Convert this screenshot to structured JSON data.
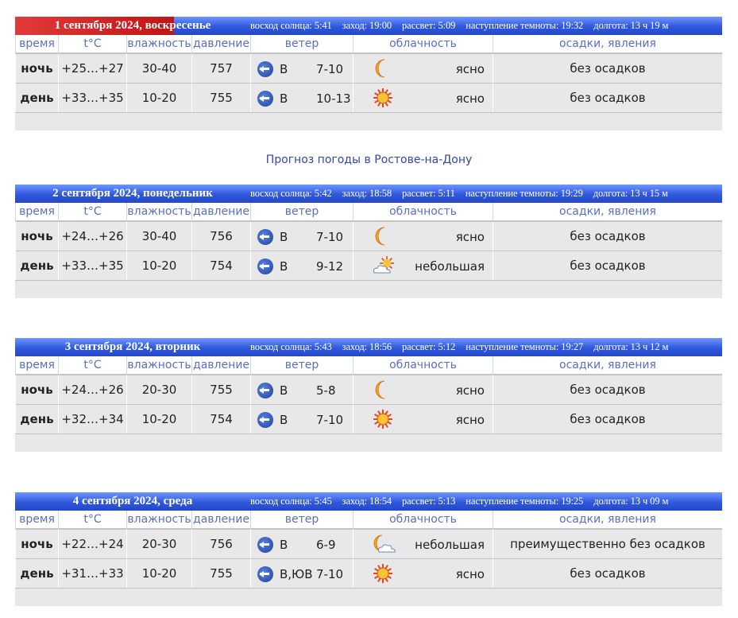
{
  "link_text": "Прогноз погоды в Ростове-на-Дону",
  "columns": [
    "время",
    "t°C",
    "влажность",
    "давление",
    "ветер",
    "облачность",
    "осадки, явления"
  ],
  "days": [
    {
      "date": "1 сентября 2024, воскресенье",
      "sunrise": "восход солнца: 5:41",
      "sunset": "заход: 19:00",
      "dawn": "рассвет: 5:09",
      "dark": "наступление темноты: 19:32",
      "length": "долгота: 13 ч 19 м",
      "rows": [
        {
          "tod": "ночь",
          "t": "+25…+27",
          "hum": "30-40",
          "press": "757",
          "wdir": "В",
          "wspd": "7-10",
          "cicon": "moon-icon",
          "cloud": "ясно",
          "prec": "без осадков"
        },
        {
          "tod": "день",
          "t": "+33…+35",
          "hum": "10-20",
          "press": "755",
          "wdir": "В",
          "wspd": "10-13",
          "cicon": "sun-icon",
          "cloud": "ясно",
          "prec": "без осадков"
        }
      ]
    },
    {
      "date": "2 сентября 2024, понедельник",
      "sunrise": "восход солнца: 5:42",
      "sunset": "заход: 18:58",
      "dawn": "рассвет: 5:11",
      "dark": "наступление темноты: 19:29",
      "length": "долгота: 13 ч 15 м",
      "rows": [
        {
          "tod": "ночь",
          "t": "+24…+26",
          "hum": "30-40",
          "press": "756",
          "wdir": "В",
          "wspd": "7-10",
          "cicon": "moon-icon",
          "cloud": "ясно",
          "prec": "без осадков"
        },
        {
          "tod": "день",
          "t": "+33…+35",
          "hum": "10-20",
          "press": "754",
          "wdir": "В",
          "wspd": "9-12",
          "cicon": "sun-cloud-icon",
          "cloud": "небольшая",
          "prec": "без осадков"
        }
      ]
    },
    {
      "date": "3 сентября 2024, вторник",
      "sunrise": "восход солнца: 5:43",
      "sunset": "заход: 18:56",
      "dawn": "рассвет: 5:12",
      "dark": "наступление темноты: 19:27",
      "length": "долгота: 13 ч 12 м",
      "rows": [
        {
          "tod": "ночь",
          "t": "+24…+26",
          "hum": "20-30",
          "press": "755",
          "wdir": "В",
          "wspd": "5-8",
          "cicon": "moon-icon",
          "cloud": "ясно",
          "prec": "без осадков"
        },
        {
          "tod": "день",
          "t": "+32…+34",
          "hum": "10-20",
          "press": "754",
          "wdir": "В",
          "wspd": "7-10",
          "cicon": "sun-icon",
          "cloud": "ясно",
          "prec": "без осадков"
        }
      ]
    },
    {
      "date": "4 сентября 2024, среда",
      "sunrise": "восход солнца: 5:45",
      "sunset": "заход: 18:54",
      "dawn": "рассвет: 5:13",
      "dark": "наступление темноты: 19:25",
      "length": "долгота: 13 ч 09 м",
      "rows": [
        {
          "tod": "ночь",
          "t": "+22…+24",
          "hum": "20-30",
          "press": "756",
          "wdir": "В",
          "wspd": "6-9",
          "cicon": "moon-cloud-icon",
          "cloud": "небольшая",
          "prec": "преимущественно без осадков"
        },
        {
          "tod": "день",
          "t": "+31…+33",
          "hum": "10-20",
          "press": "755",
          "wdir": "В,ЮВ",
          "wspd": "7-10",
          "cicon": "sun-icon",
          "cloud": "ясно",
          "prec": "без осадков"
        }
      ]
    }
  ]
}
